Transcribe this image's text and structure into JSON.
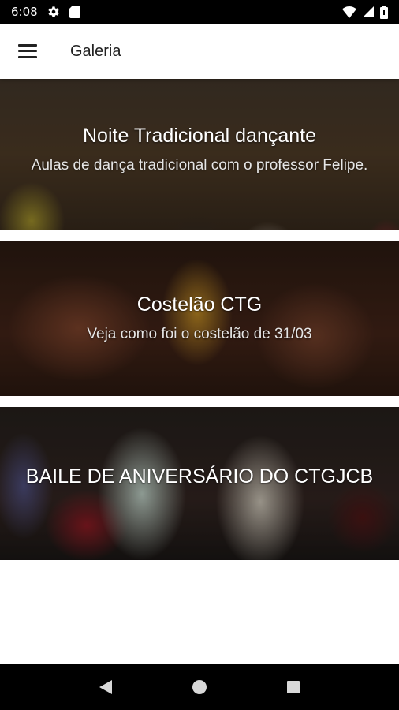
{
  "status_bar": {
    "time": "6:08",
    "icons": [
      "gear-icon",
      "sd-card-icon",
      "wifi-icon",
      "signal-icon",
      "battery-icon"
    ]
  },
  "app_bar": {
    "title": "Galeria",
    "menu_icon": "hamburger-menu-icon"
  },
  "gallery": {
    "items": [
      {
        "title": "Noite Tradicional dançante",
        "subtitle": "Aulas de dança tradicional com o professor Felipe."
      },
      {
        "title": "Costelão CTG",
        "subtitle": "Veja como foi o costelão de 31/03"
      },
      {
        "title": "BAILE DE ANIVERSÁRIO DO CTGJCB",
        "subtitle": ""
      }
    ]
  },
  "nav_bar": {
    "icons": [
      "back-icon",
      "home-icon",
      "recents-icon"
    ]
  },
  "colors": {
    "status_bar_bg": "#000000",
    "app_bar_bg": "#ffffff",
    "nav_bar_bg": "#000000",
    "title_text": "#ffffff"
  }
}
